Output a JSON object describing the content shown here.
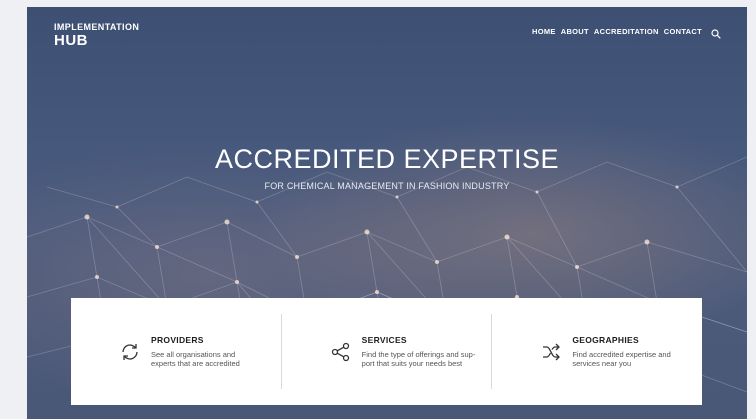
{
  "logo": {
    "line1": "IMPLEMENTATION",
    "line2": "HUB"
  },
  "nav": {
    "items": [
      "HOME",
      "ABOUT",
      "ACCREDITATION",
      "CONTACT"
    ],
    "search_icon": "search-icon"
  },
  "hero": {
    "title": "ACCREDITED EXPERTISE",
    "subtitle": "FOR CHEMICAL MANAGEMENT IN FASHION INDUSTRY"
  },
  "cards": [
    {
      "title": "PROVIDERS",
      "description": "See all organisations and\nexperts that are accredited",
      "icon": "refresh-icon"
    },
    {
      "title": "SERVICES",
      "description": "Find the type of offerings and sup-\nport that suits your needs best",
      "icon": "share-icon"
    },
    {
      "title": "GEOGRAPHIES",
      "description": "Find accredited expertise and\nservices near you",
      "icon": "shuffle-icon"
    }
  ],
  "colors": {
    "hero_base": "#46587c",
    "card_bg": "#ffffff",
    "title_text": "#1d1d1d"
  }
}
